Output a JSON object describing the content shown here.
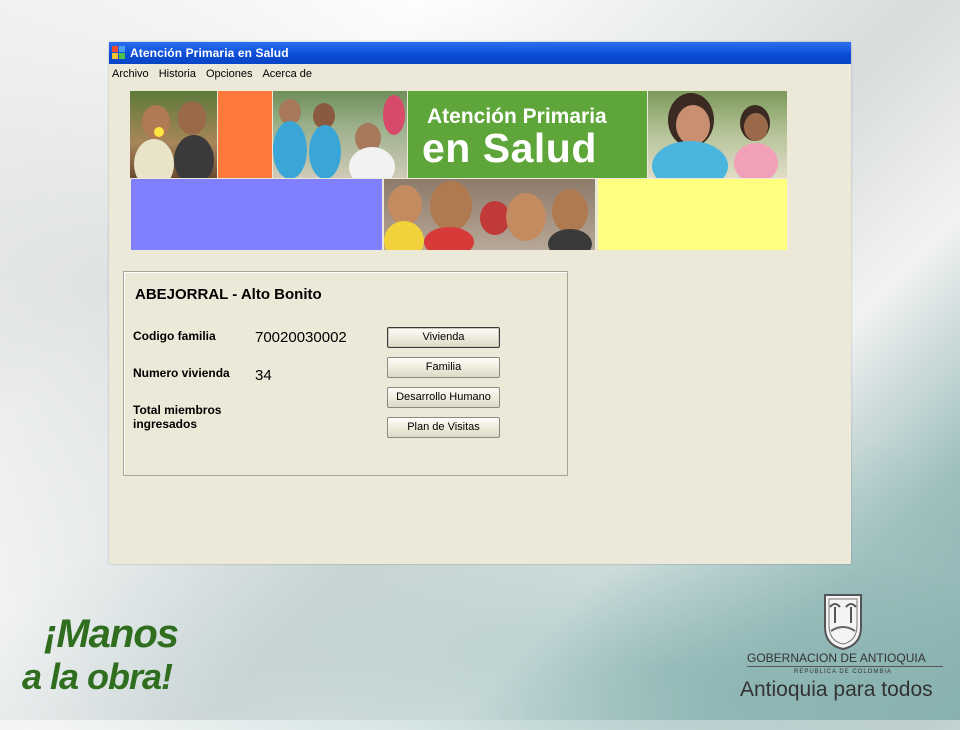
{
  "window": {
    "title": "Atención Primaria en Salud",
    "menu": [
      "Archivo",
      "Historia",
      "Opciones",
      "Acerca de"
    ]
  },
  "banner": {
    "line1": "Atención Primaria",
    "line2": "en Salud",
    "colors": {
      "orange": "#ff7a3a",
      "purple": "#8080ff",
      "yellow": "#ffff80",
      "green": "#5fa63a"
    }
  },
  "group": {
    "title": "ABEJORRAL - Alto Bonito",
    "codigo_label": "Codigo familia",
    "codigo_value": "70020030002",
    "numero_label": "Numero vivienda",
    "numero_value": "34",
    "total_label_1": "Total miembros",
    "total_label_2": "ingresados"
  },
  "buttons": {
    "vivienda": "Vivienda",
    "familia": "Familia",
    "desarrollo": "Desarrollo Humano",
    "plan": "Plan de Visitas"
  },
  "slogan": {
    "line1": "¡Manos",
    "line2": "a la obra!"
  },
  "gov": {
    "title": "GOBERNACION DE ANTIOQUIA",
    "subtitle": "REPUBLICA DE COLOMBIA",
    "tagline": "Antioquia para todos"
  }
}
